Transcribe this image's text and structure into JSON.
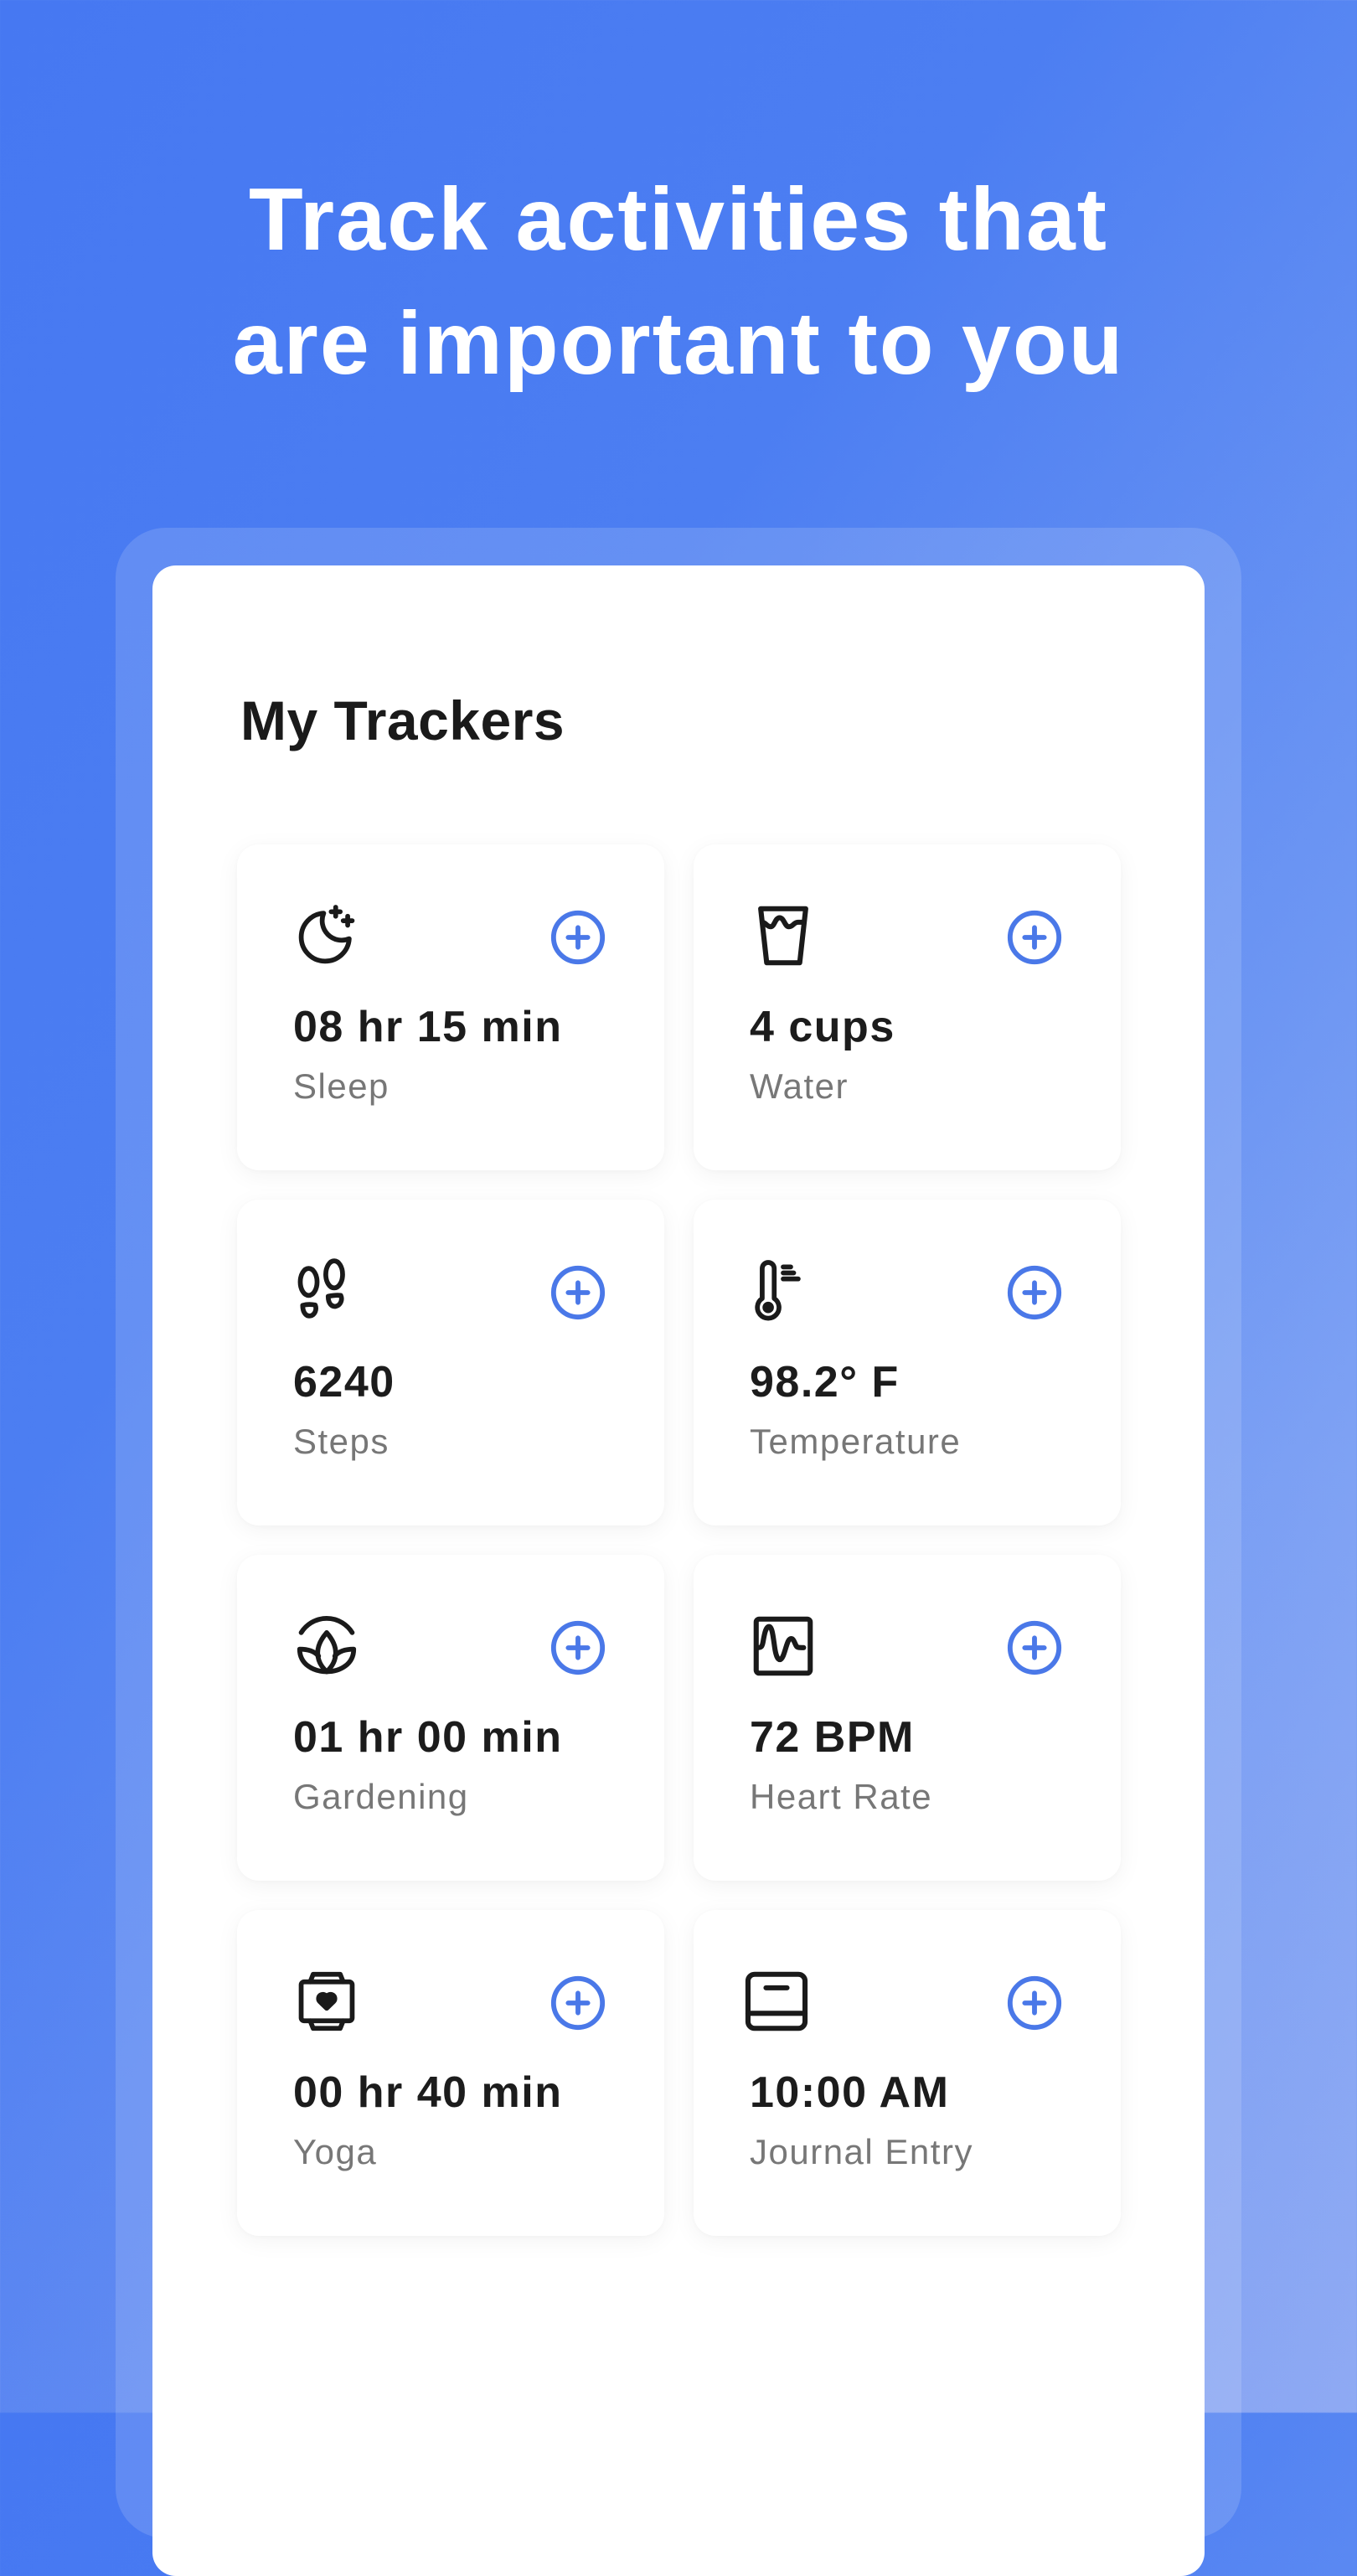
{
  "headline": {
    "line1": "Track activities that",
    "line2": "are important to you"
  },
  "card": {
    "title": "My Trackers"
  },
  "colors": {
    "accent": "#4a78e8",
    "text_primary": "#1c1c1c",
    "text_secondary": "#777777",
    "background_start": "#4678f2",
    "background_end": "#9db6f5"
  },
  "trackers": [
    {
      "icon": "moon-stars-icon",
      "value": "08 hr 15 min",
      "label": "Sleep"
    },
    {
      "icon": "water-glass-icon",
      "value": "4 cups",
      "label": "Water"
    },
    {
      "icon": "footprints-icon",
      "value": "6240",
      "label": "Steps"
    },
    {
      "icon": "thermometer-icon",
      "value": "98.2° F",
      "label": "Temperature"
    },
    {
      "icon": "lotus-icon",
      "value": "01 hr 00 min",
      "label": "Gardening"
    },
    {
      "icon": "heart-rate-monitor-icon",
      "value": "72 BPM",
      "label": "Heart Rate"
    },
    {
      "icon": "smartwatch-heart-icon",
      "value": "00 hr 40 min",
      "label": "Yoga"
    },
    {
      "icon": "journal-book-icon",
      "value": "10:00 AM",
      "label": "Journal Entry"
    }
  ],
  "add_button": {
    "icon": "plus-circle-icon"
  }
}
